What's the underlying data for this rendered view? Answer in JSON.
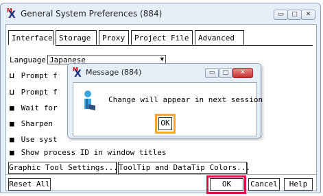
{
  "main_window": {
    "title": "General System Preferences (884)",
    "controls": {
      "minimize": "▭",
      "maximize": "□",
      "close": "✕"
    }
  },
  "tabs": [
    {
      "label": "Interface",
      "active": true
    },
    {
      "label": "Storage"
    },
    {
      "label": "Proxy"
    },
    {
      "label": "Project File"
    },
    {
      "label": "Advanced"
    }
  ],
  "language": {
    "label": "Language",
    "value": "Japanese"
  },
  "options": [
    {
      "text": "Prompt f",
      "checked": false
    },
    {
      "text": "Prompt f",
      "checked": false
    },
    {
      "text": "Wait for",
      "checked": true
    },
    {
      "text": "Sharpen",
      "checked": true
    },
    {
      "text": "Use syst",
      "checked": true
    },
    {
      "text": "Show process ID in window titles",
      "checked": true
    }
  ],
  "checkbox_glyphs": {
    "checked": "■",
    "unchecked": "⊔"
  },
  "buttons": {
    "graphic_tool": "Graphic Tool Settings...",
    "tooltip_colors": "ToolTip and DataTip Colors...",
    "reset_all": "Reset All",
    "ok": "OK",
    "cancel": "Cancel",
    "help": "Help"
  },
  "dialog": {
    "title": "Message (884)",
    "message": "Change will appear in next session",
    "ok": "OK"
  },
  "colors": {
    "highlight_main_ok": "#d4144a",
    "highlight_dialog_ok": "#f3a73a"
  }
}
